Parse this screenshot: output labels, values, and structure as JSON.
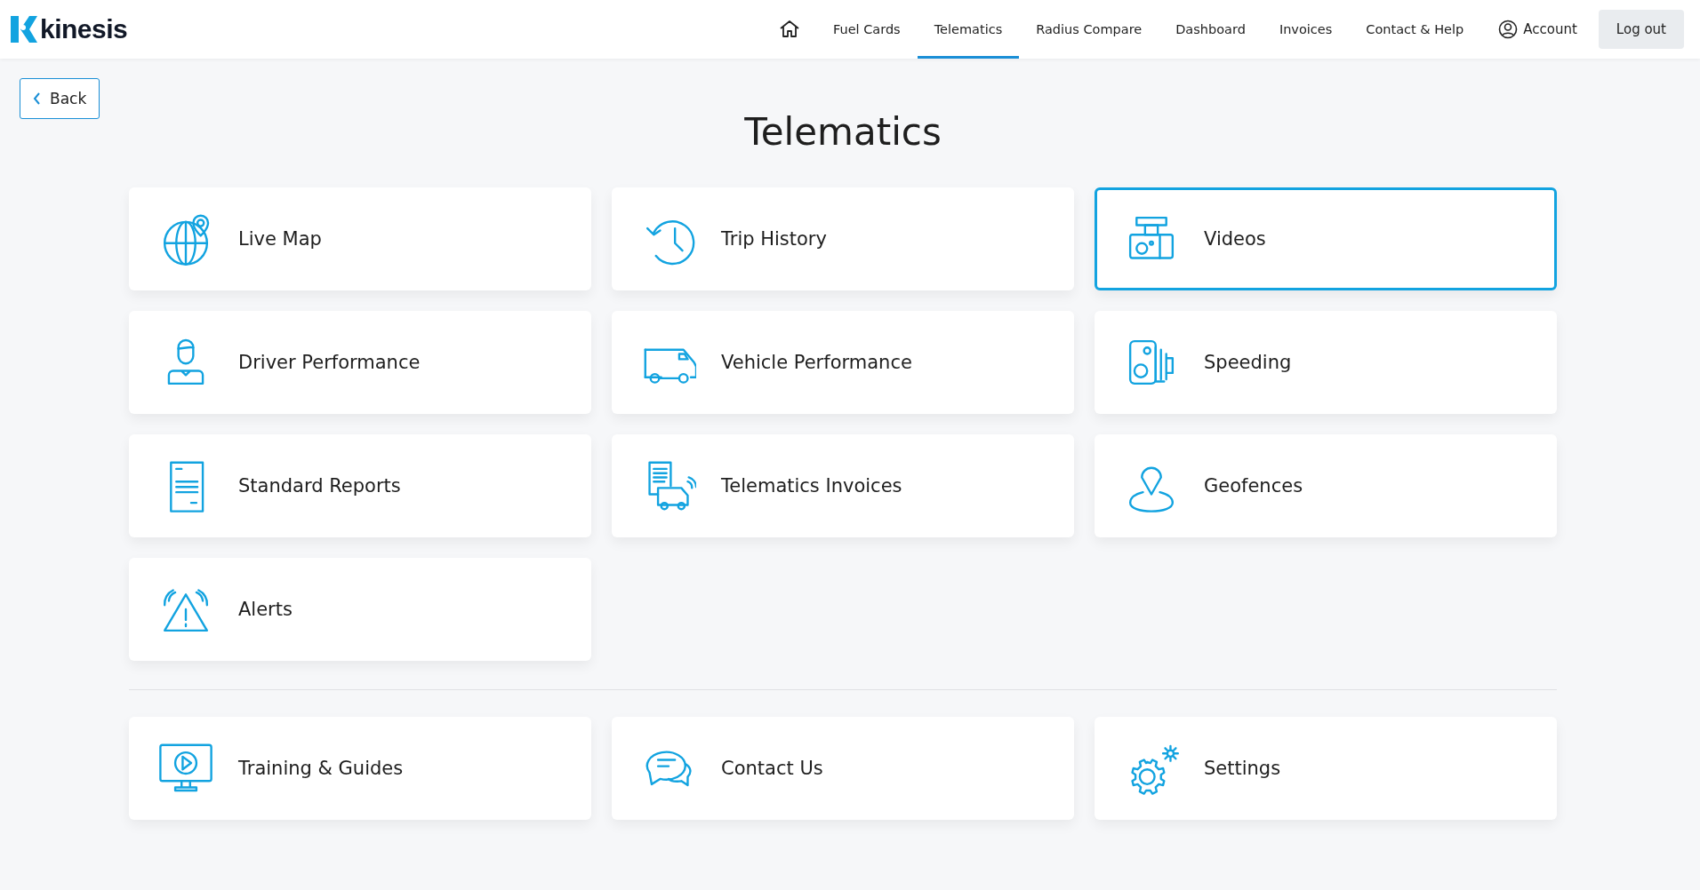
{
  "header": {
    "logo": "kinesis",
    "nav": [
      {
        "label": "Fuel Cards",
        "selected": false
      },
      {
        "label": "Telematics",
        "selected": true
      },
      {
        "label": "Radius Compare",
        "selected": false
      },
      {
        "label": "Dashboard",
        "selected": false
      },
      {
        "label": "Invoices",
        "selected": false
      },
      {
        "label": "Contact & Help",
        "selected": false
      }
    ],
    "account": "Account",
    "logout": "Log out"
  },
  "back": "Back",
  "title": "Telematics",
  "tiles": [
    {
      "kind": "map",
      "label": "Live Map",
      "selected": false
    },
    {
      "kind": "history",
      "label": "Trip History",
      "selected": false
    },
    {
      "kind": "camera",
      "label": "Videos",
      "selected": true
    },
    {
      "kind": "driver",
      "label": "Driver Performance",
      "selected": false
    },
    {
      "kind": "van",
      "label": "Vehicle Performance",
      "selected": false
    },
    {
      "kind": "speed",
      "label": "Speeding",
      "selected": false
    },
    {
      "kind": "report",
      "label": "Standard Reports",
      "selected": false
    },
    {
      "kind": "invoice",
      "label": "Telematics Invoices",
      "selected": false
    },
    {
      "kind": "geofence",
      "label": "Geofences",
      "selected": false
    },
    {
      "kind": "alert",
      "label": "Alerts",
      "selected": false
    }
  ],
  "support_tiles": [
    {
      "kind": "training",
      "label": "Training & Guides",
      "selected": false
    },
    {
      "kind": "chat",
      "label": "Contact Us",
      "selected": false
    },
    {
      "kind": "settings",
      "label": "Settings",
      "selected": false
    }
  ]
}
